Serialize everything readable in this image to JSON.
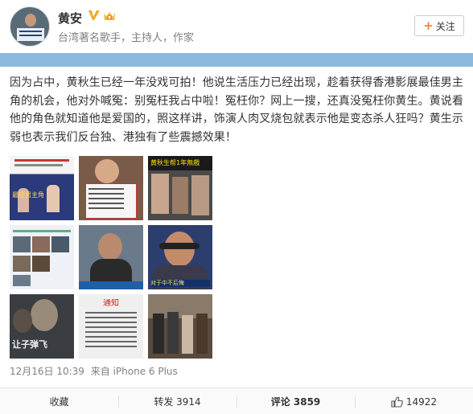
{
  "user": {
    "name": "黄安",
    "bio": "台湾著名歌手，主持人，作家",
    "follow_label": "关注",
    "follow_plus": "+"
  },
  "post": {
    "text": "因为占中，黄秋生已经一年没戏可拍！他说生活压力已经出现，趁着获得香港影展最佳男主角的机会，他对外喊冤：别冤枉我占中啦！冤枉你？网上一搜，还真没冤枉你黄生。黄说看他的角色就知道他是爱国的，照这样讲，饰演人肉叉烧包就表示他是变态杀人狂吗？黄生示弱也表示我们反台独、港独有了些震撼效果！",
    "photos": [
      {
        "name": "photo-1",
        "caption": "最佳男主角"
      },
      {
        "name": "photo-2",
        "caption": ""
      },
      {
        "name": "photo-3",
        "caption": "黄秋生帮1年無戲"
      },
      {
        "name": "photo-4",
        "caption": ""
      },
      {
        "name": "photo-5",
        "caption": ""
      },
      {
        "name": "photo-6",
        "caption": "对于中不后悔"
      },
      {
        "name": "photo-7",
        "caption": "让子弹飞"
      },
      {
        "name": "photo-8",
        "caption": "通知"
      },
      {
        "name": "photo-9",
        "caption": ""
      }
    ],
    "time": "12月16日 10:39",
    "source": "来自 iPhone 6 Plus"
  },
  "actions": {
    "favorite": "收藏",
    "repost": "转发 3914",
    "comment": "评论 3859",
    "like": "14922"
  },
  "colors": {
    "banner": "#8ab9dc",
    "accent": "#ff8140",
    "muted": "#808080"
  }
}
